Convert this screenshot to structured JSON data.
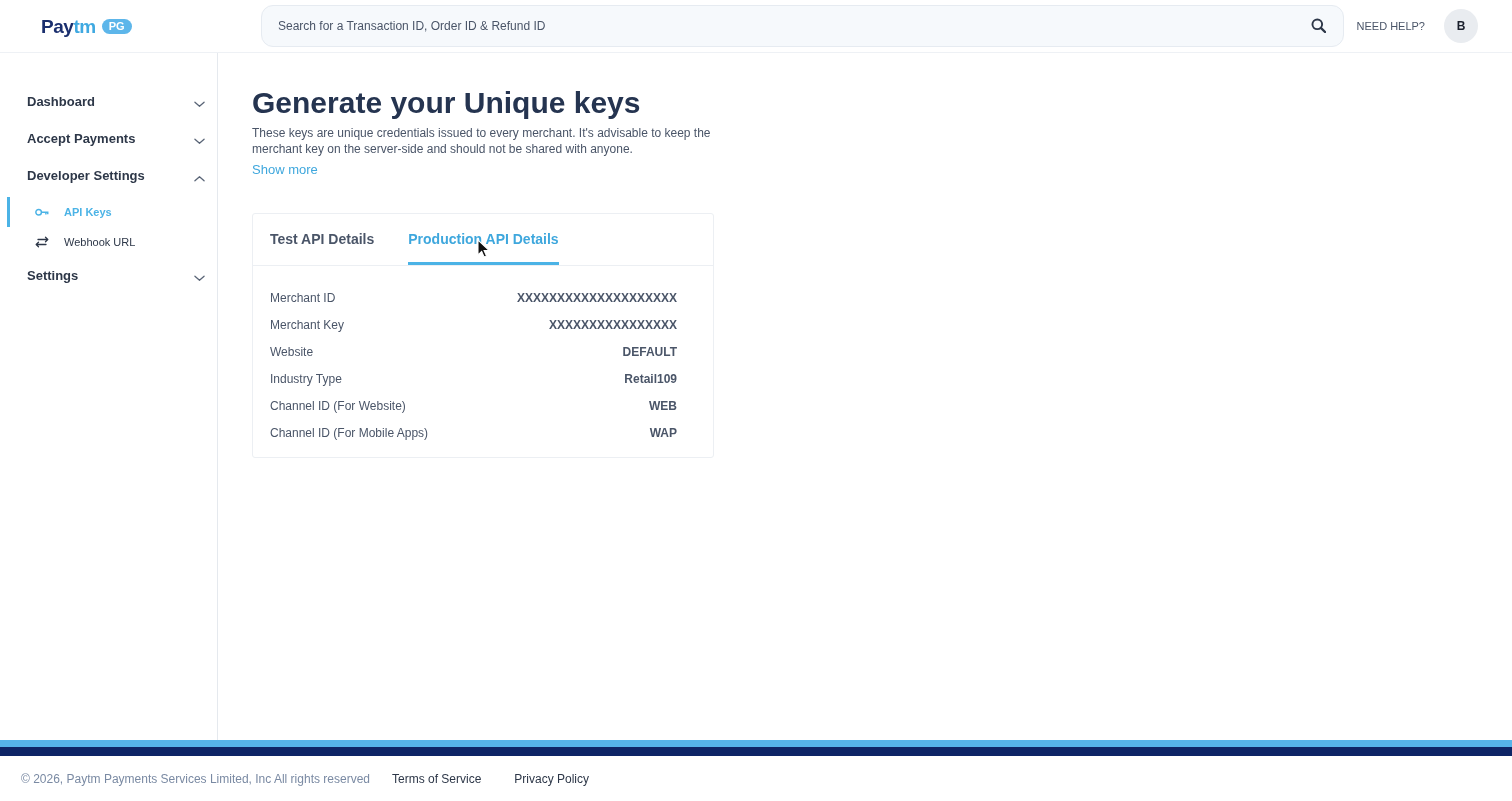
{
  "header": {
    "logo": {
      "name_part_1": "Pay",
      "name_part_2": "tm",
      "badge": "PG"
    },
    "search": {
      "placeholder": "Search for a Transaction ID, Order ID & Refund ID"
    },
    "help_link": "NEED HELP?",
    "avatar": "B"
  },
  "sidebar": {
    "items": [
      {
        "label": "Dashboard",
        "expanded": false
      },
      {
        "label": "Accept Payments",
        "expanded": false
      },
      {
        "label": "Developer Settings",
        "expanded": true,
        "children": [
          {
            "label": "API Keys",
            "selected": true
          },
          {
            "label": "Webhook URL",
            "selected": false
          }
        ]
      },
      {
        "label": "Settings",
        "expanded": false
      }
    ]
  },
  "main": {
    "title": "Generate your Unique keys",
    "description": "These keys are unique credentials issued to every merchant. It's advisable to keep the merchant key on the server-side and should not be shared with anyone.",
    "show_more": "Show more",
    "card": {
      "tabs": [
        {
          "label": "Test API Details",
          "selected": false
        },
        {
          "label": "Production API Details",
          "selected": true
        }
      ],
      "rows": [
        {
          "label": "Merchant ID",
          "value": "XXXXXXXXXXXXXXXXXXXX"
        },
        {
          "label": "Merchant Key",
          "value": "XXXXXXXXXXXXXXXX"
        },
        {
          "label": "Website",
          "value": "DEFAULT"
        },
        {
          "label": "Industry Type",
          "value": "Retail109"
        },
        {
          "label": "Channel ID (For Website)",
          "value": "WEB"
        },
        {
          "label": "Channel ID (For Mobile Apps)",
          "value": "WAP"
        }
      ]
    }
  },
  "footer": {
    "copyright": "© 2026, Paytm Payments Services Limited, Inc All rights reserved",
    "links": [
      "Terms of Service",
      "Privacy Policy"
    ]
  }
}
